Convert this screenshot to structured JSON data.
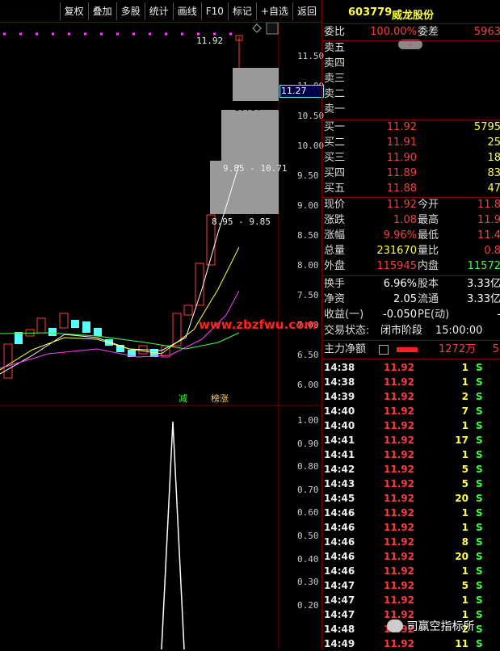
{
  "toolbar": {
    "buttons": [
      "复权",
      "叠加",
      "多股",
      "统计",
      "画线",
      "F10",
      "标记",
      "+自选",
      "返回"
    ]
  },
  "chart": {
    "price_axis": [
      "11.50",
      "11.00",
      "10.50",
      "10.00",
      "9.50",
      "9.00",
      "8.50",
      "8.00",
      "7.50",
      "7.00",
      "6.50",
      "6.00"
    ],
    "current_price_box": "11.27",
    "high_label": "11.92",
    "range_labels": [
      "10.84 - 11",
      "9.85 - 10.71",
      "8.95 - 9.85"
    ],
    "signal_jian": "减",
    "signal_bangzhang": "榜涨",
    "indicator_axis": [
      "1.00",
      "0.90",
      "0.80",
      "0.70",
      "0.60",
      "0.50",
      "0.40",
      "0.30",
      "0.20"
    ],
    "watermark": "www.zbzfwu.com"
  },
  "quote": {
    "code": "603779",
    "name": "威龙股份",
    "weibi_label": "委比",
    "weibi_value": "100.00%",
    "weicha_label": "委差",
    "weicha_value": "5963",
    "sell": [
      {
        "label": "卖五"
      },
      {
        "label": "卖四"
      },
      {
        "label": "卖三"
      },
      {
        "label": "卖二"
      },
      {
        "label": "卖一"
      }
    ],
    "buy": [
      {
        "label": "买一",
        "price": "11.92",
        "vol": "5795"
      },
      {
        "label": "买二",
        "price": "11.91",
        "vol": "25"
      },
      {
        "label": "买三",
        "price": "11.90",
        "vol": "18"
      },
      {
        "label": "买四",
        "price": "11.89",
        "vol": "83"
      },
      {
        "label": "买五",
        "price": "11.88",
        "vol": "47"
      }
    ],
    "stats": [
      {
        "l1": "现价",
        "v1": "11.92",
        "l2": "今开",
        "v2": "11.8"
      },
      {
        "l1": "涨跌",
        "v1": "1.08",
        "l2": "最高",
        "v2": "11.9"
      },
      {
        "l1": "涨幅",
        "v1": "9.96%",
        "l2": "最低",
        "v2": "11.4"
      },
      {
        "l1": "总量",
        "v1": "231670",
        "l2": "量比",
        "v2": "0.8"
      },
      {
        "l1": "外盘",
        "v1": "115945",
        "l2": "内盘",
        "v2": "11572"
      },
      {
        "l1": "换手",
        "v1": "6.96%",
        "l2": "股本",
        "v2": "3.33亿"
      },
      {
        "l1": "净资",
        "v1": "2.05",
        "l2": "流通",
        "v2": "3.33亿"
      },
      {
        "l1": "收益(一)",
        "v1": "-0.050",
        "l2": "PE(动)",
        "v2": "-"
      }
    ],
    "trade_status_label": "交易状态:",
    "trade_status_value": "闭市阶段",
    "trade_status_time": "15:00:00",
    "main_net_label": "主力净额",
    "main_net_value": "1272万",
    "main_net_extra": "5",
    "trades": [
      {
        "time": "14:38",
        "price": "11.92",
        "vol": "1",
        "side": "S"
      },
      {
        "time": "14:38",
        "price": "11.92",
        "vol": "1",
        "side": "S"
      },
      {
        "time": "14:39",
        "price": "11.92",
        "vol": "2",
        "side": "S"
      },
      {
        "time": "14:40",
        "price": "11.92",
        "vol": "7",
        "side": "S"
      },
      {
        "time": "14:40",
        "price": "11.92",
        "vol": "1",
        "side": "S"
      },
      {
        "time": "14:41",
        "price": "11.92",
        "vol": "17",
        "side": "S"
      },
      {
        "time": "14:41",
        "price": "11.92",
        "vol": "1",
        "side": "S"
      },
      {
        "time": "14:42",
        "price": "11.92",
        "vol": "5",
        "side": "S"
      },
      {
        "time": "14:43",
        "price": "11.92",
        "vol": "5",
        "side": "S"
      },
      {
        "time": "14:45",
        "price": "11.92",
        "vol": "20",
        "side": "S"
      },
      {
        "time": "14:46",
        "price": "11.92",
        "vol": "1",
        "side": "S"
      },
      {
        "time": "14:46",
        "price": "11.92",
        "vol": "1",
        "side": "S"
      },
      {
        "time": "14:46",
        "price": "11.92",
        "vol": "8",
        "side": "S"
      },
      {
        "time": "14:46",
        "price": "11.92",
        "vol": "20",
        "side": "S"
      },
      {
        "time": "14:46",
        "price": "11.92",
        "vol": "1",
        "side": "S"
      },
      {
        "time": "14:47",
        "price": "11.92",
        "vol": "5",
        "side": "S"
      },
      {
        "time": "14:47",
        "price": "11.92",
        "vol": "1",
        "side": "S"
      },
      {
        "time": "14:47",
        "price": "11.92",
        "vol": "1",
        "side": "S"
      },
      {
        "time": "14:48",
        "price": "11.92",
        "vol": "2",
        "side": "S"
      },
      {
        "time": "14:49",
        "price": "11.92",
        "vol": "11",
        "side": "S"
      }
    ],
    "wechat_label": "司赢空指标所"
  },
  "colors": {
    "up": "#ff3b3b",
    "down": "#55ffff",
    "ma5": "#ffffff",
    "ma10": "#ffff44",
    "ma20": "#ff44ff",
    "ma60": "#44ff44",
    "chip": "#999999"
  }
}
